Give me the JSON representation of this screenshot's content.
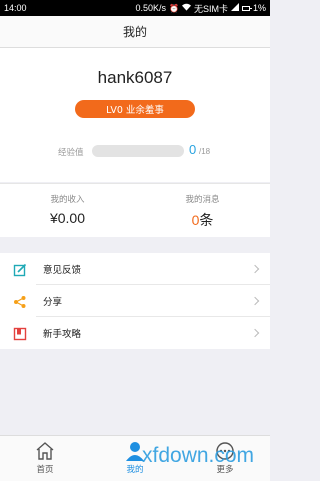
{
  "status_bar": {
    "time": "14:00",
    "speed": "0.50K/s",
    "sim": "无SIM卡",
    "battery": "1%"
  },
  "header": {
    "title": "我的"
  },
  "profile": {
    "username": "hank6087",
    "level_badge": "LV0 业余羞事",
    "exp_label": "经验值",
    "exp_value": "0",
    "exp_max": "/18",
    "exp_progress": 0
  },
  "stats": {
    "income_label": "我的收入",
    "income_value": "¥0.00",
    "messages_label": "我的消息",
    "messages_count": "0",
    "messages_unit": "条"
  },
  "menu": {
    "items": [
      {
        "label": "意见反馈",
        "icon": "edit-icon"
      },
      {
        "label": "分享",
        "icon": "share-icon"
      },
      {
        "label": "新手攻略",
        "icon": "bookmark-icon"
      }
    ]
  },
  "tabbar": {
    "tabs": [
      {
        "label": "首页",
        "icon": "home-icon"
      },
      {
        "label": "我的",
        "icon": "user-icon"
      },
      {
        "label": "更多",
        "icon": "more-icon"
      }
    ]
  },
  "watermark": "xfdown.com",
  "colors": {
    "accent": "#f26a1b",
    "blue": "#1e8fe1",
    "exp_blue": "#29a3e0",
    "background": "#efeff4"
  }
}
